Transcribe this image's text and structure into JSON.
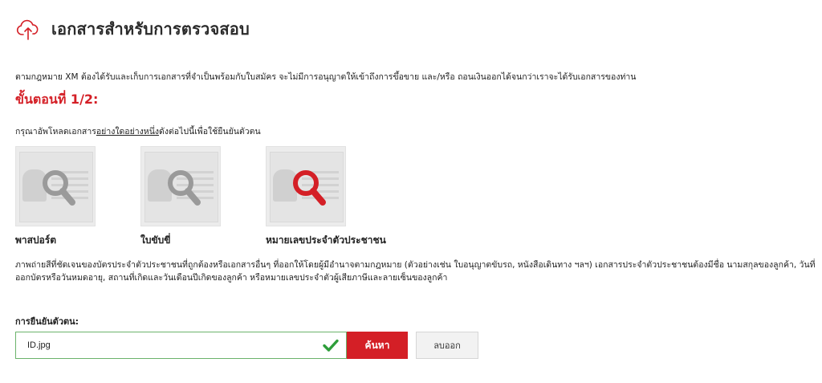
{
  "header": {
    "icon": "cloud-upload-icon",
    "title": "เอกสารสำหรับการตรวจสอบ"
  },
  "intro_text": "ตามกฎหมาย XM ต้องได้รับและเก็บการเอกสารที่จำเป็นพร้อมกับใบสมัคร จะไม่มีการอนุญาตให้เข้าถึงการขึ้อขาย และ/หรือ ถอนเงินออกได้จนกว่าเราจะได้รับเอกสารของท่าน",
  "step_title": "ขั้นตอนที่ 1/2:",
  "instruction": {
    "before": "กรุณาอัพโหลดเอกสาร",
    "underlined": "อย่างใดอย่างหนึ่ง",
    "after": "ดังต่อไปนี้เพื่อใช้ยืนยันตัวตน"
  },
  "documents": [
    {
      "label": "พาสปอร์ต",
      "icon": "search-icon",
      "selected": false
    },
    {
      "label": "ใบขับขี่",
      "icon": "search-icon",
      "selected": false
    },
    {
      "label": "หมายเลขประจำตัวประชาชน",
      "icon": "search-icon",
      "selected": true
    }
  ],
  "description": "ภาพถ่ายสีที่ชัดเจนของบัตรประจำตัวประชาชนที่ถูกต้องหรือเอกสารอื่นๆ ที่ออกให้โดยผู้มีอำนาจตามกฎหมาย (ตัวอย่างเช่น ใบอนุญาตขับรถ, หนังสือเดินทาง ฯลฯ) เอกสารประจำตัวประชาชนต้องมีชื่อ นามสกุลของลูกค้า, วันที่ออกบัตรหรือวันหมดอายุ, สถานที่เกิดและวันเดือนปีเกิดของลูกค้า หรือหมายเลขประจำตัวผู้เสียภาษีและลายเซ็นของลูกค้า",
  "verify": {
    "label": "การยืนยันตัวตน:",
    "file_value": "ID.jpg",
    "status_icon": "check-icon",
    "browse_label": "ค้นหา",
    "remove_label": "ลบออก"
  },
  "colors": {
    "accent": "#d41f26",
    "success": "#2e9e3a",
    "icon_grey": "#9a9a9a"
  }
}
